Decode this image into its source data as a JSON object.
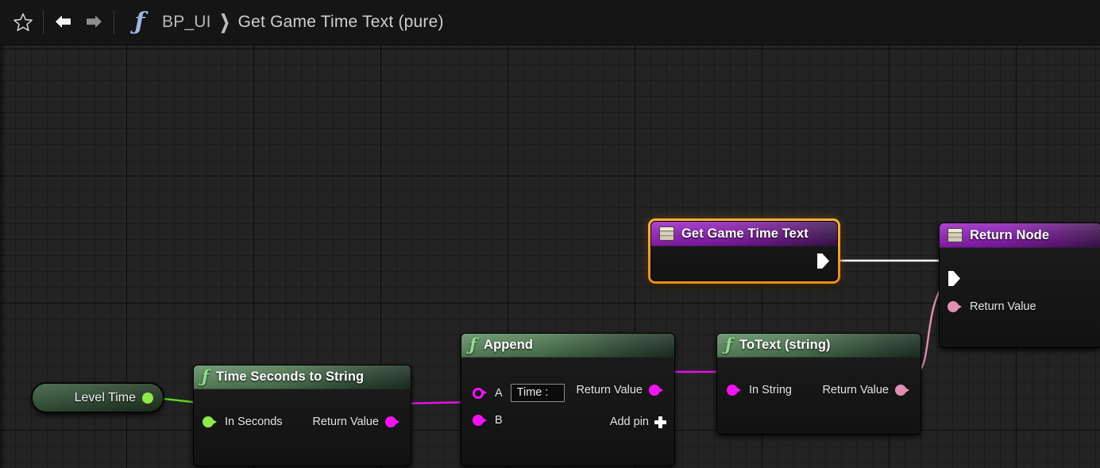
{
  "toolbar": {
    "favorite_icon": "star-icon",
    "back_icon": "arrow-left-icon",
    "forward_icon": "arrow-right-icon",
    "function_icon": "function-f-icon",
    "breadcrumb": {
      "root": "BP_UI",
      "separator": "❯",
      "current": "Get Game Time Text (pure)"
    }
  },
  "graph": {
    "nodes": [
      {
        "id": "get-game-time-text",
        "title": "Get Game Time Text",
        "header_icon": "entry-node-icon",
        "header_color": "#8a19b4",
        "selected": true,
        "selection_color": "#f49b16",
        "pins": [
          {
            "name": "exec-out",
            "label": "",
            "type": "exec",
            "side": "right",
            "color": "#ffffff",
            "connected": true
          }
        ]
      },
      {
        "id": "return-node",
        "title": "Return Node",
        "header_icon": "result-node-icon",
        "header_color": "#8a19b4",
        "selected": false,
        "pins": [
          {
            "name": "exec-in",
            "label": "",
            "type": "exec",
            "side": "left",
            "color": "#ffffff",
            "connected": true
          },
          {
            "name": "return-value",
            "label": "Return Value",
            "type": "text",
            "side": "left",
            "color": "#e08fb0",
            "connected": true
          }
        ]
      },
      {
        "id": "append",
        "title": "Append",
        "header_icon": "function-f-icon",
        "header_color": "#4e7a52",
        "selected": false,
        "pins": [
          {
            "name": "pin-a",
            "label": "A",
            "type": "string",
            "side": "left",
            "color": "#f312f3",
            "connected": false,
            "value": "Time :"
          },
          {
            "name": "pin-b",
            "label": "B",
            "type": "string",
            "side": "left",
            "color": "#f312f3",
            "connected": true
          },
          {
            "name": "return-value",
            "label": "Return Value",
            "type": "string",
            "side": "right",
            "color": "#f312f3",
            "connected": true
          }
        ],
        "add_pin_label": "Add pin",
        "add_pin_icon": "plus-icon"
      },
      {
        "id": "to-text-string",
        "title": "ToText (string)",
        "header_icon": "function-f-icon",
        "header_color": "#4e7a52",
        "selected": false,
        "pins": [
          {
            "name": "in-string",
            "label": "In String",
            "type": "string",
            "side": "left",
            "color": "#f312f3",
            "connected": true
          },
          {
            "name": "return-value",
            "label": "Return Value",
            "type": "text",
            "side": "right",
            "color": "#e08fb0",
            "connected": true
          }
        ]
      },
      {
        "id": "time-seconds-to-string",
        "title": "Time Seconds to String",
        "header_icon": "function-f-icon",
        "header_color": "#4e7a52",
        "selected": false,
        "pins": [
          {
            "name": "in-seconds",
            "label": "In Seconds",
            "type": "float",
            "side": "left",
            "color": "#8ee84a",
            "connected": true
          },
          {
            "name": "return-value",
            "label": "Return Value",
            "type": "string",
            "side": "right",
            "color": "#f312f3",
            "connected": true
          }
        ]
      },
      {
        "id": "level-time",
        "title": "Level Time",
        "kind": "variable-getter",
        "pins": [
          {
            "name": "value-out",
            "label": "",
            "type": "float",
            "side": "right",
            "color": "#8ee84a",
            "connected": true
          }
        ]
      }
    ],
    "wire_colors": {
      "exec": "#ffffff",
      "float": "#5cd81d",
      "string": "#e812e8",
      "text": "#e08fb0"
    }
  },
  "titles": {
    "get_game_time_text": "Get Game Time Text",
    "return_node": "Return Node",
    "append": "Append",
    "to_text_string": "ToText (string)",
    "time_seconds_to_string": "Time Seconds to String",
    "level_time": "Level Time"
  },
  "labels": {
    "return_value": "Return Value",
    "pin_a": "A",
    "pin_b": "B",
    "append_a_value": "Time :",
    "add_pin": "Add pin",
    "in_string": "In String",
    "in_seconds": "In Seconds"
  }
}
